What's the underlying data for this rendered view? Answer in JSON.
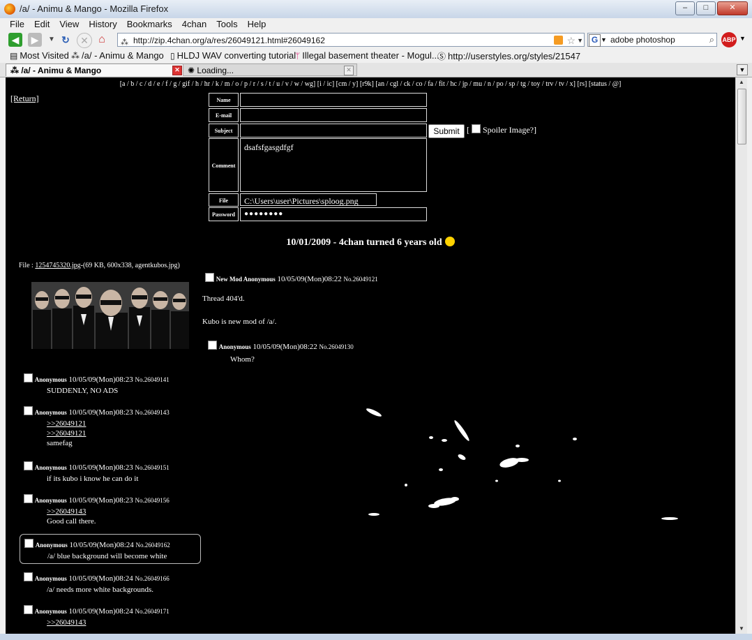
{
  "window": {
    "title": "/a/ - Animu & Mango - Mozilla Firefox",
    "minimize": "–",
    "maximize": "□",
    "close": "✕"
  },
  "menu": [
    "File",
    "Edit",
    "View",
    "History",
    "Bookmarks",
    "4chan",
    "Tools",
    "Help"
  ],
  "nav": {
    "url": "http://zip.4chan.org/a/res/26049121.html#26049162",
    "search": "adobe photoshop",
    "abp": "ABP"
  },
  "bookmarks": [
    {
      "label": "Most Visited"
    },
    {
      "label": "/a/ - Animu & Mango"
    },
    {
      "label": "HLDJ WAV converting tutorial"
    },
    {
      "label": "Illegal basement theater - Mogul..."
    },
    {
      "label": "http://userstyles.org/styles/21547"
    }
  ],
  "tabs": [
    {
      "label": "/a/ - Animu & Mango"
    },
    {
      "label": "Loading..."
    }
  ],
  "page": {
    "boardnav": "[a / b / c / d / e / f / g / gif / h / hr / k / m / o / p / r / s / t / u / v / w / wg] [i / ic] [cm / y] [r9k] [an / cgl / ck / co / fa / fit / hc / jp / mu / n / po / sp / tg / toy / trv / tv / x] [rs] [status / @]",
    "return": "[Return]",
    "form": {
      "name_label": "Name",
      "email_label": "E-mail",
      "subject_label": "Subject",
      "comment_label": "Comment",
      "file_label": "File",
      "password_label": "Password",
      "comment_value": "dsafsfgasgdfgf",
      "file_value": "C:\\Users\\user\\Pictures\\sploog.png",
      "password_value": "●●●●●●●●",
      "submit": "Submit",
      "spoiler_open": "[",
      "spoiler": "Spoiler Image?]"
    },
    "announcement": "10/01/2009 - 4chan turned 6 years old",
    "file": {
      "prefix": "File :",
      "link": "1254745320.jpg",
      "meta": "-(69 KB, 600x338, agentkubos.jpg)"
    },
    "op": {
      "name": "New Mod Anonymous",
      "date": "10/05/09(Mon)08:22",
      "no": "No.26049121",
      "lines": [
        "Thread 404'd.",
        "Kubo is new mod of /a/."
      ]
    },
    "inline_reply": {
      "name": "Anonymous",
      "date": "10/05/09(Mon)08:22",
      "no": "No.26049130",
      "text": "Whom?"
    },
    "replies": [
      {
        "name": "Anonymous",
        "date": "10/05/09(Mon)08:23",
        "no": "No.26049141",
        "lines": [
          "SUDDENLY, NO ADS"
        ]
      },
      {
        "name": "Anonymous",
        "date": "10/05/09(Mon)08:23",
        "no": "No.26049143",
        "quotes": [
          ">>26049121",
          ">>26049121"
        ],
        "lines": [
          "samefag"
        ]
      },
      {
        "name": "Anonymous",
        "date": "10/05/09(Mon)08:23",
        "no": "No.26049151",
        "lines": [
          "if its kubo i know he can do it"
        ]
      },
      {
        "name": "Anonymous",
        "date": "10/05/09(Mon)08:23",
        "no": "No.26049156",
        "quotes": [
          ">>26049143"
        ],
        "lines": [
          "Good call there."
        ]
      },
      {
        "name": "Anonymous",
        "date": "10/05/09(Mon)08:24",
        "no": "No.26049162",
        "lines": [
          "/a/ blue background will become white"
        ]
      },
      {
        "name": "Anonymous",
        "date": "10/05/09(Mon)08:24",
        "no": "No.26049166",
        "lines": [
          "/a/ needs more white backgrounds."
        ]
      },
      {
        "name": "Anonymous",
        "date": "10/05/09(Mon)08:24",
        "no": "No.26049171",
        "quotes": [
          ">>26049143"
        ],
        "lines": []
      }
    ]
  },
  "colors": {
    "page_bg": "#000000",
    "text": "#ffffff",
    "chrome": "#f0f0f0"
  }
}
